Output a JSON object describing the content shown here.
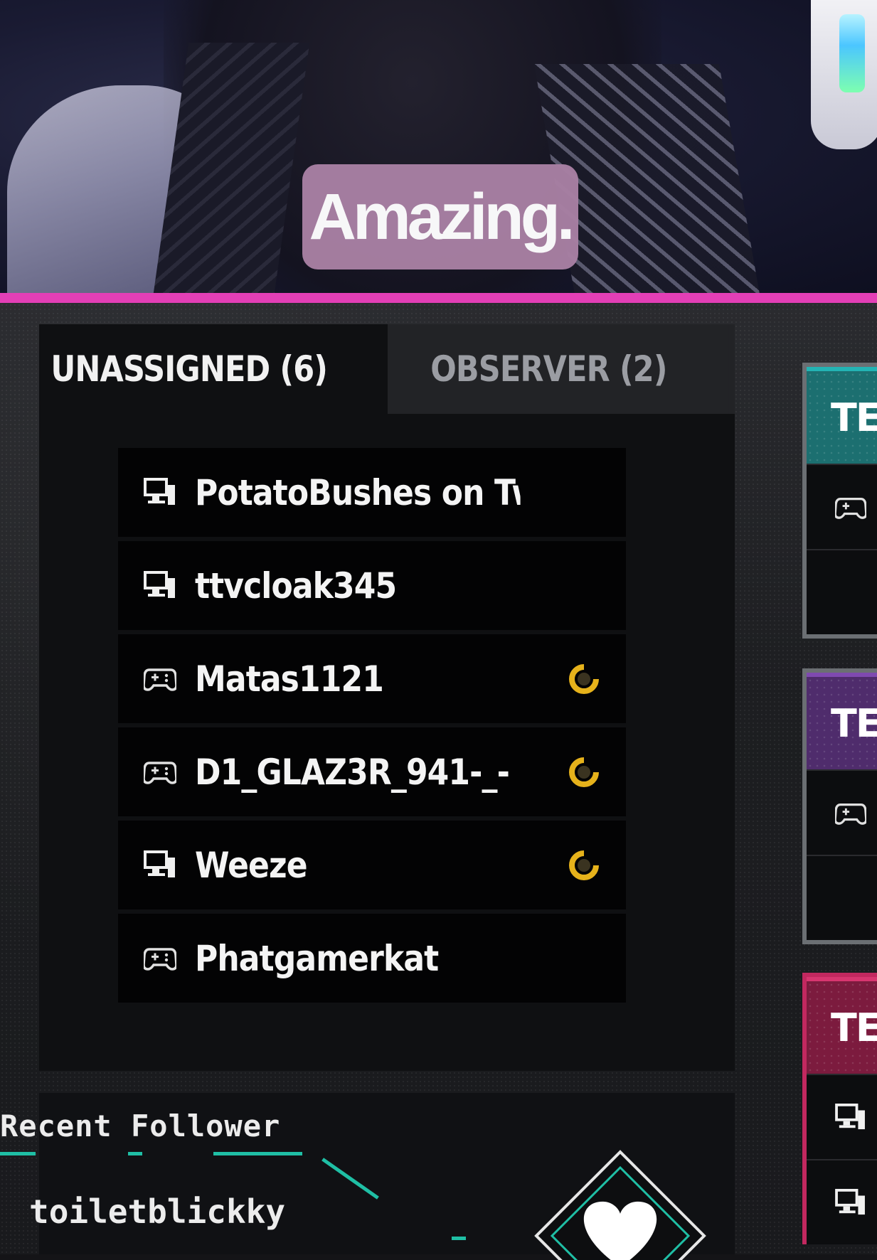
{
  "overlay": {
    "caption": "Amazing."
  },
  "lobby": {
    "tabs": [
      {
        "label": "UNASSIGNED (6)",
        "active": true
      },
      {
        "label": "OBSERVER (2)",
        "active": false
      }
    ],
    "players": [
      {
        "name": "PotatoBushes on Twitc",
        "platform": "pc-icon",
        "status": null
      },
      {
        "name": "ttvcloak345",
        "platform": "pc-icon",
        "status": null
      },
      {
        "name": "Matas1121",
        "platform": "controller-icon",
        "status": "loading-icon"
      },
      {
        "name": "D1_GLAZ3R_941-_-",
        "platform": "controller-icon",
        "status": "loading-icon"
      },
      {
        "name": "Weeze",
        "platform": "pc-icon",
        "status": "loading-icon"
      },
      {
        "name": "Phatgamerkat",
        "platform": "controller-icon",
        "status": null
      }
    ],
    "teams": [
      {
        "label": "TE",
        "color": "#1c8e8c"
      },
      {
        "label": "TE",
        "color": "#6b3b8e"
      },
      {
        "label": "TE",
        "color": "#c2285f"
      }
    ]
  },
  "follower": {
    "title": "Recent Follower",
    "name": "toiletblickky",
    "accent": "#1fbfa5"
  },
  "colors": {
    "stream_border": "#e33fb6",
    "caption_bg": "#a880a3",
    "loading": "#e6b21b"
  }
}
